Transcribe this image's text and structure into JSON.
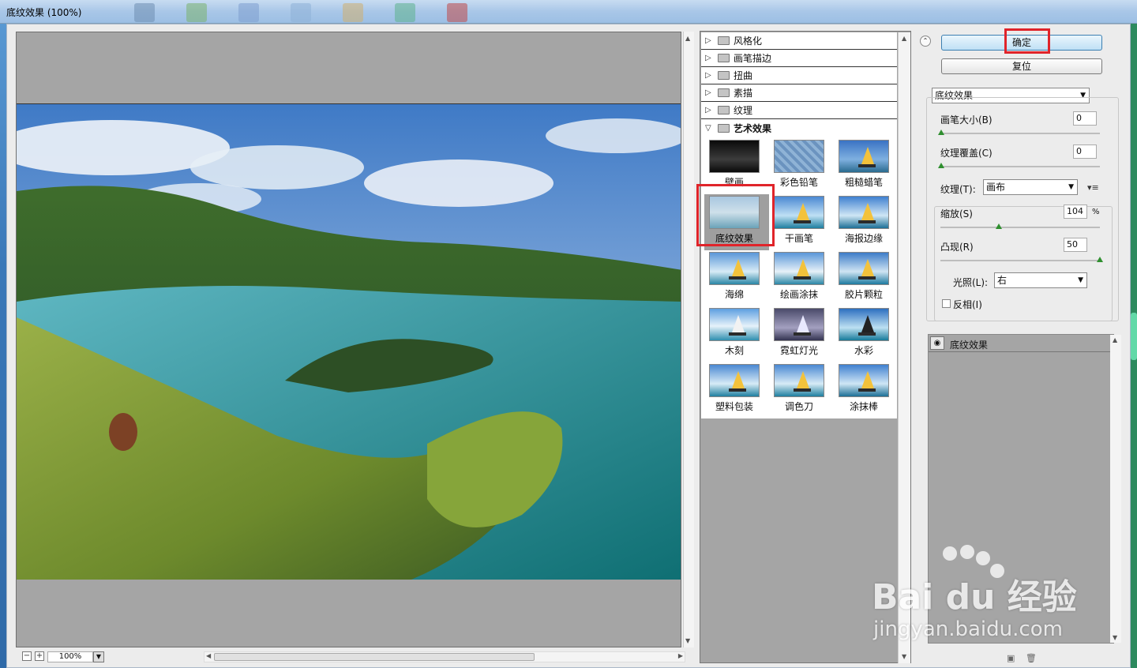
{
  "window": {
    "title": "底纹效果 (100%)"
  },
  "preview": {
    "zoom": "100%"
  },
  "filters": {
    "categories": [
      {
        "label": "风格化",
        "expanded": false
      },
      {
        "label": "画笔描边",
        "expanded": false
      },
      {
        "label": "扭曲",
        "expanded": false
      },
      {
        "label": "素描",
        "expanded": false
      },
      {
        "label": "纹理",
        "expanded": false
      },
      {
        "label": "艺术效果",
        "expanded": true
      }
    ],
    "thumbs": [
      {
        "label": "壁画"
      },
      {
        "label": "彩色铅笔"
      },
      {
        "label": "粗糙蜡笔"
      },
      {
        "label": "底纹效果",
        "selected": true
      },
      {
        "label": "干画笔"
      },
      {
        "label": "海报边缘"
      },
      {
        "label": "海绵"
      },
      {
        "label": "绘画涂抹"
      },
      {
        "label": "胶片颗粒"
      },
      {
        "label": "木刻"
      },
      {
        "label": "霓虹灯光"
      },
      {
        "label": "水彩"
      },
      {
        "label": "塑料包装"
      },
      {
        "label": "调色刀"
      },
      {
        "label": "涂抹棒"
      }
    ]
  },
  "settings": {
    "ok_label": "确定",
    "reset_label": "复位",
    "filter_select": "底纹效果",
    "brush_size_label": "画笔大小(B)",
    "brush_size_value": "0",
    "texture_coverage_label": "纹理覆盖(C)",
    "texture_coverage_value": "0",
    "texture_label": "纹理(T):",
    "texture_value": "画布",
    "scaling_label": "缩放(S)",
    "scaling_value": "104",
    "scaling_unit": "%",
    "relief_label": "凸现(R)",
    "relief_value": "50",
    "light_label": "光照(L):",
    "light_value": "右",
    "invert_label": "反相(I)",
    "invert_checked": false
  },
  "layers": {
    "items": [
      {
        "label": "底纹效果",
        "visible": true
      }
    ]
  },
  "watermark": {
    "brand": "Bai du 经验",
    "url": "jingyan.baidu.com"
  }
}
